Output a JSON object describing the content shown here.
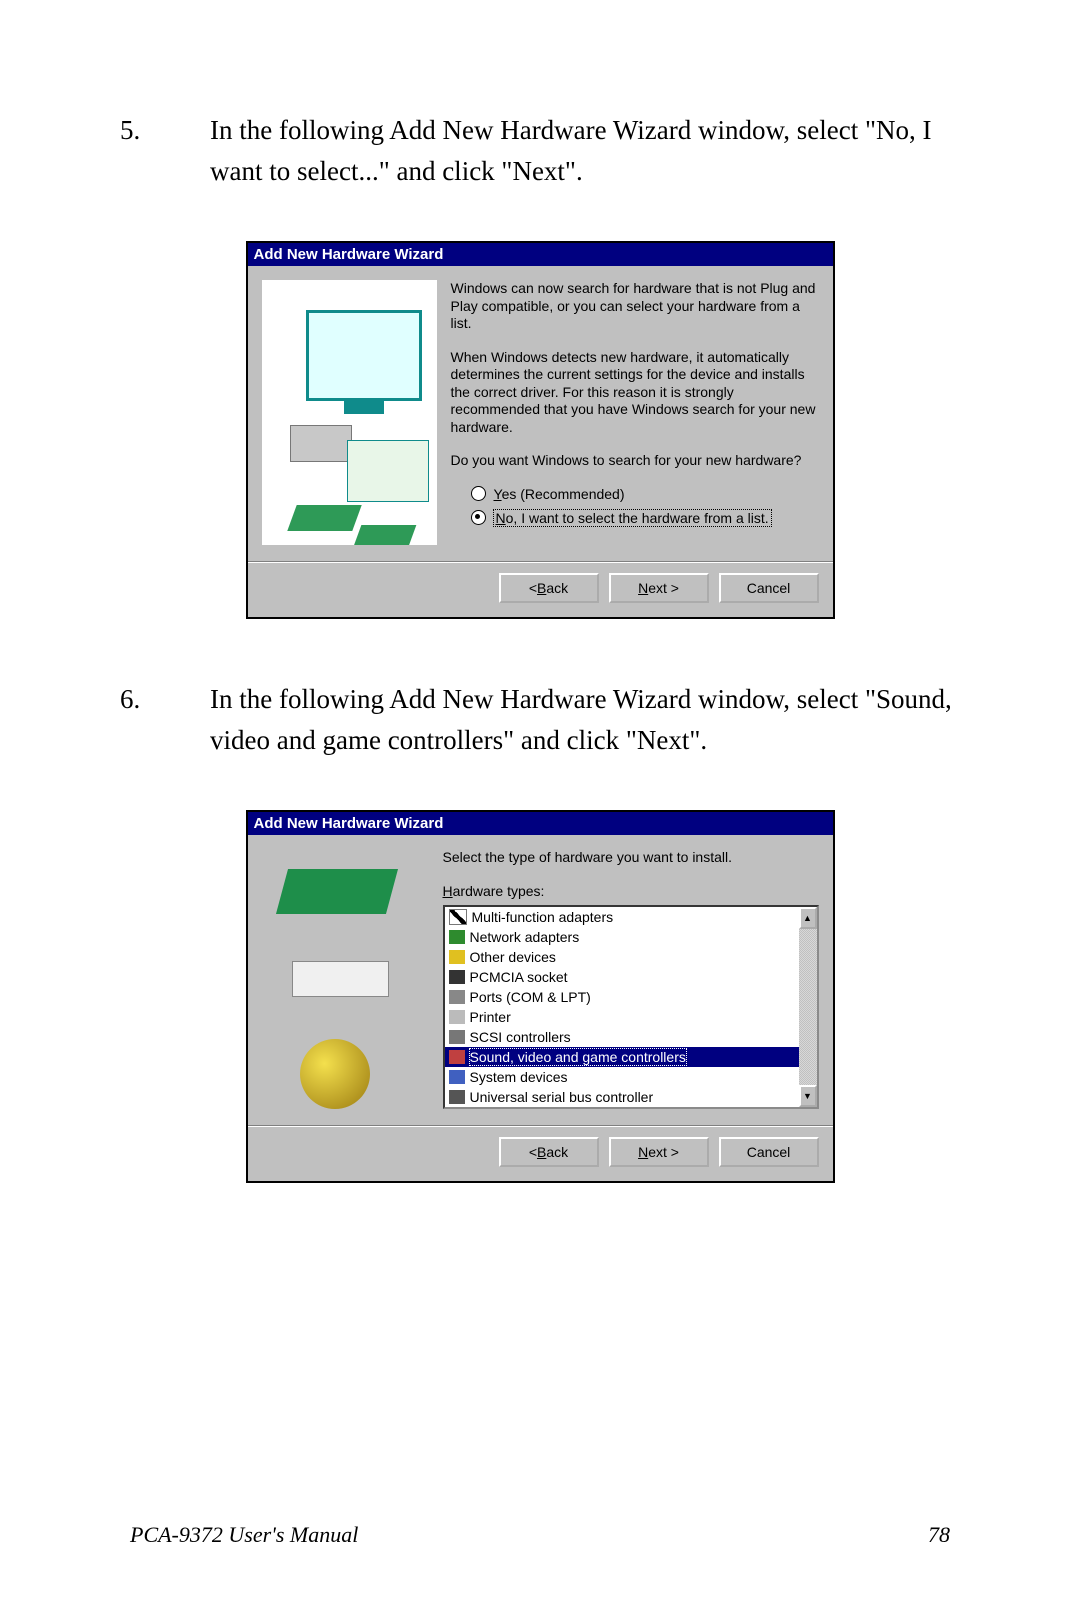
{
  "steps": {
    "s5_num": "5.",
    "s5_text": "In the following Add New Hardware Wizard window, select \"No, I want to select...\" and click \"Next\".",
    "s6_num": "6.",
    "s6_text": "In the following Add New Hardware Wizard window, select \"Sound, video and game controllers\" and click \"Next\"."
  },
  "dialog1": {
    "title": "Add New Hardware Wizard",
    "p1": "Windows can now search for hardware that is not Plug and Play compatible, or you can select your hardware from a list.",
    "p2": "When Windows detects new hardware, it automatically determines the current settings for the device and installs the correct driver. For this reason it is strongly recommended that you have Windows search for your new hardware.",
    "p3": "Do you want Windows to search for your new hardware?",
    "opt_yes_pre": "Y",
    "opt_yes_rest": "es (Recommended)",
    "opt_no_pre": "N",
    "opt_no_rest": "o, I want to select the hardware from a list.",
    "back_pre": "< ",
    "back_u": "B",
    "back_rest": "ack",
    "next_pre": "",
    "next_u": "N",
    "next_rest": "ext >",
    "cancel": "Cancel"
  },
  "dialog2": {
    "title": "Add New Hardware Wizard",
    "prompt": "Select the type of hardware you want to install.",
    "list_label_u": "H",
    "list_label_rest": "ardware types:",
    "items": {
      "i0": "Multi-function adapters",
      "i1": "Network adapters",
      "i2": "Other devices",
      "i3": "PCMCIA socket",
      "i4": "Ports (COM & LPT)",
      "i5": "Printer",
      "i6": "SCSI controllers",
      "i7": "Sound, video and game controllers",
      "i8": "System devices",
      "i9": "Universal serial bus controller"
    },
    "back_pre": "< ",
    "back_u": "B",
    "back_rest": "ack",
    "next_u": "N",
    "next_rest": "ext >",
    "cancel": "Cancel",
    "scroll_up": "▲",
    "scroll_down": "▼"
  },
  "footer": {
    "left": "PCA-9372 User's Manual",
    "right": "78"
  }
}
